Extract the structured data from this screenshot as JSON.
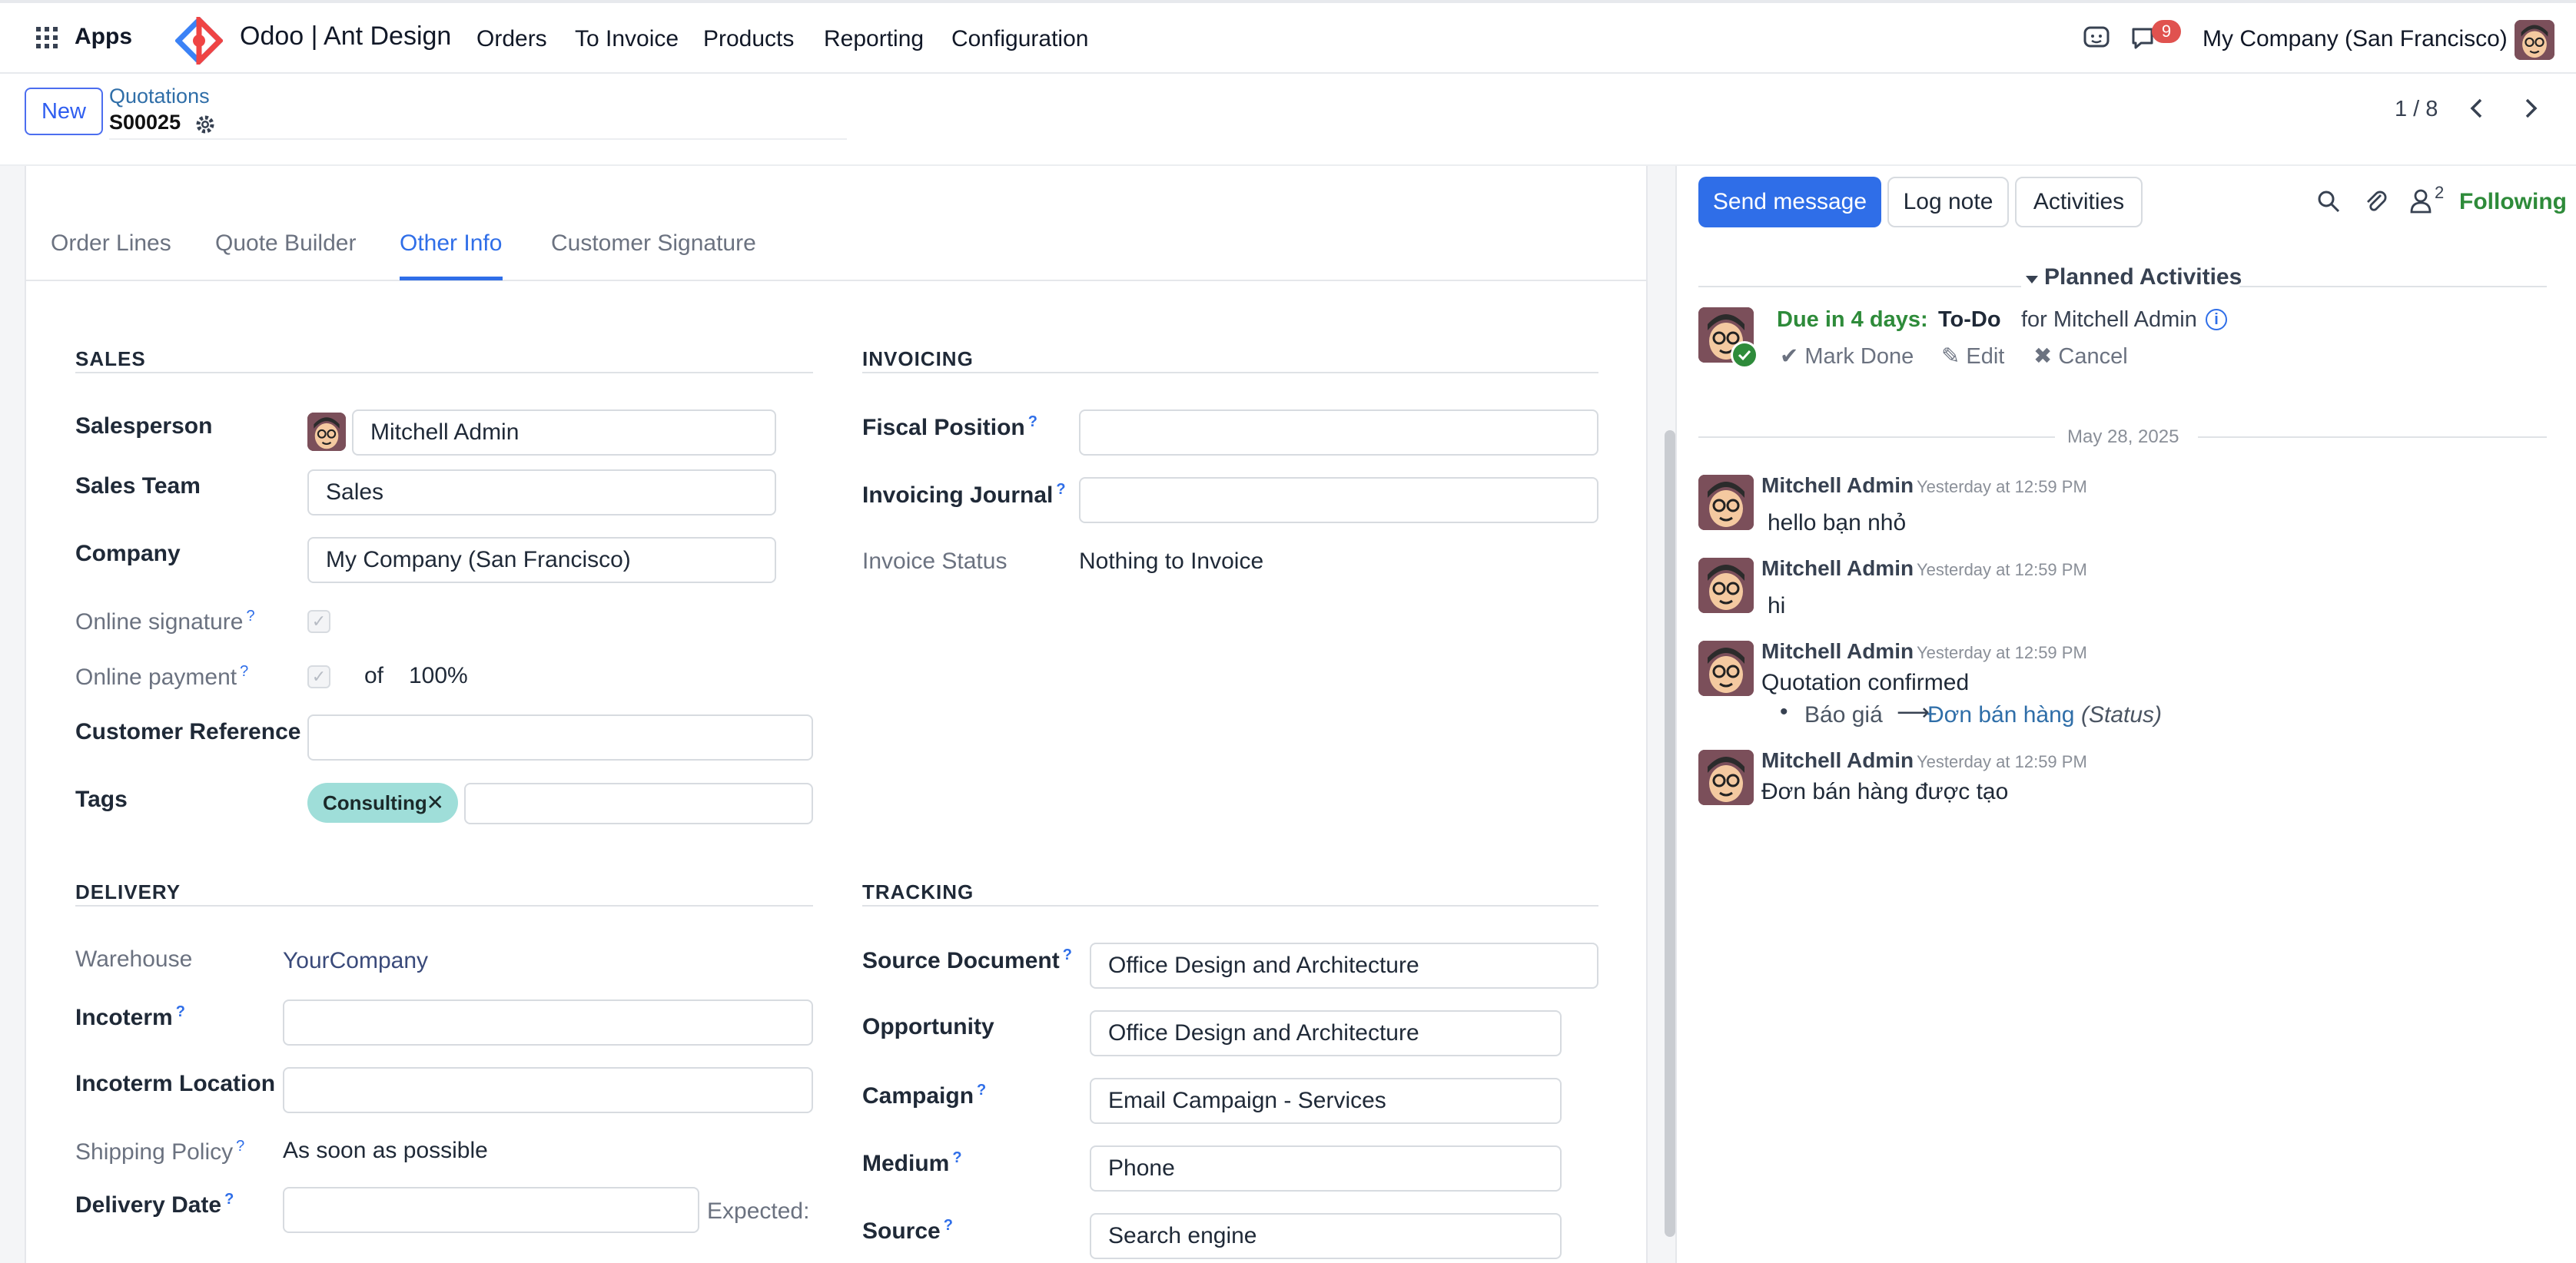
{
  "navbar": {
    "apps_label": "Apps",
    "brand": "Odoo | Ant Design",
    "menu": [
      "Orders",
      "To Invoice",
      "Products",
      "Reporting",
      "Configuration"
    ],
    "messages_badge": "9",
    "company": "My Company (San Francisco)"
  },
  "control": {
    "new_label": "New",
    "breadcrumb_parent": "Quotations",
    "record_name": "S00025",
    "pager": "1 / 8"
  },
  "tabs": [
    {
      "label": "Order Lines",
      "active": false
    },
    {
      "label": "Quote Builder",
      "active": false
    },
    {
      "label": "Other Info",
      "active": true
    },
    {
      "label": "Customer Signature",
      "active": false
    }
  ],
  "sales": {
    "title": "SALES",
    "salesperson_label": "Salesperson",
    "salesperson": "Mitchell Admin",
    "team_label": "Sales Team",
    "team": "Sales",
    "company_label": "Company",
    "company": "My Company (San Francisco)",
    "online_signature_label": "Online signature",
    "online_payment_label": "Online payment",
    "of_label": "of",
    "payment_percent": "100%",
    "customer_ref_label": "Customer Reference",
    "tags_label": "Tags",
    "tag": "Consulting"
  },
  "invoicing": {
    "title": "INVOICING",
    "fiscal_label": "Fiscal Position",
    "journal_label": "Invoicing Journal",
    "status_label": "Invoice Status",
    "status": "Nothing to Invoice"
  },
  "delivery": {
    "title": "DELIVERY",
    "warehouse_label": "Warehouse",
    "warehouse": "YourCompany",
    "incoterm_label": "Incoterm",
    "incoterm_location_label": "Incoterm Location",
    "shipping_policy_label": "Shipping Policy",
    "shipping_policy": "As soon as possible",
    "delivery_date_label": "Delivery Date",
    "expected_label": "Expected:"
  },
  "tracking": {
    "title": "TRACKING",
    "source_doc_label": "Source Document",
    "source_doc": "Office Design and Architecture",
    "opportunity_label": "Opportunity",
    "opportunity": "Office Design and Architecture",
    "campaign_label": "Campaign",
    "campaign": "Email Campaign - Services",
    "medium_label": "Medium",
    "medium": "Phone",
    "source_label": "Source",
    "source": "Search engine"
  },
  "chatter": {
    "send_message": "Send message",
    "log_note": "Log note",
    "activities": "Activities",
    "followers_count": "2",
    "following": "Following",
    "planned_title": "Planned Activities",
    "activity_due": "Due in 4 days:",
    "activity_type": "To-Do",
    "activity_for": "for Mitchell Admin",
    "mark_done": "Mark Done",
    "edit": "Edit",
    "cancel": "Cancel",
    "date_separator": "May 28, 2025",
    "messages": [
      {
        "author": "Mitchell Admin",
        "time": "Yesterday at 12:59 PM",
        "body": "hello bạn nhỏ"
      },
      {
        "author": "Mitchell Admin",
        "time": "Yesterday at 12:59 PM",
        "body": "hi"
      },
      {
        "author": "Mitchell Admin",
        "time": "Yesterday at 12:59 PM",
        "body": "Quotation confirmed",
        "tracking_old": "Báo giá",
        "tracking_new": "Đơn bán hàng",
        "tracking_field": "(Status)"
      },
      {
        "author": "Mitchell Admin",
        "time": "Yesterday at 12:59 PM",
        "body": "Đơn bán hàng được tạo"
      }
    ]
  },
  "colors": {
    "primary": "#2f6ee8",
    "tag": "#9fded9",
    "success": "#2e8b3a",
    "badge": "#e0524f"
  }
}
